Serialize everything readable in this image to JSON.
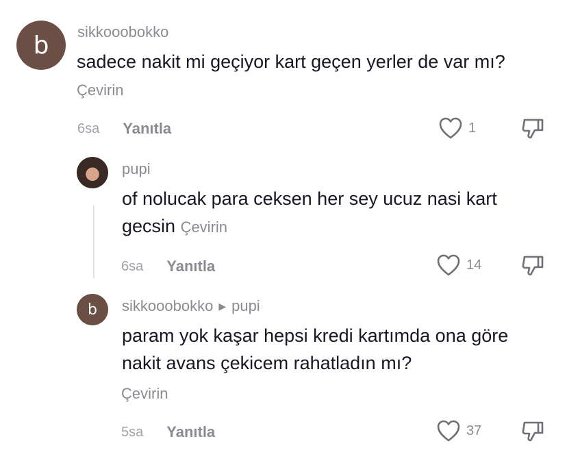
{
  "comments": [
    {
      "avatar_letter": "b",
      "username": "sikkooobokko",
      "text": "sadece nakit mi geçiyor kart geçen yerler de var mı?",
      "translate": "Çevirin",
      "time": "6sa",
      "reply": "Yanıtla",
      "likes": "1"
    },
    {
      "username": "pupi",
      "text": "of nolucak para ceksen her sey ucuz nasi kart gecsin",
      "translate": "Çevirin",
      "time": "6sa",
      "reply": "Yanıtla",
      "likes": "14"
    },
    {
      "avatar_letter": "b",
      "username": "sikkooobokko",
      "reply_to": "pupi",
      "text": "param yok kaşar hepsi kredi kartımda ona göre nakit avans çekicem rahatladın mı?",
      "translate": "Çevirin",
      "time": "5sa",
      "reply": "Yanıtla",
      "likes": "37"
    }
  ]
}
